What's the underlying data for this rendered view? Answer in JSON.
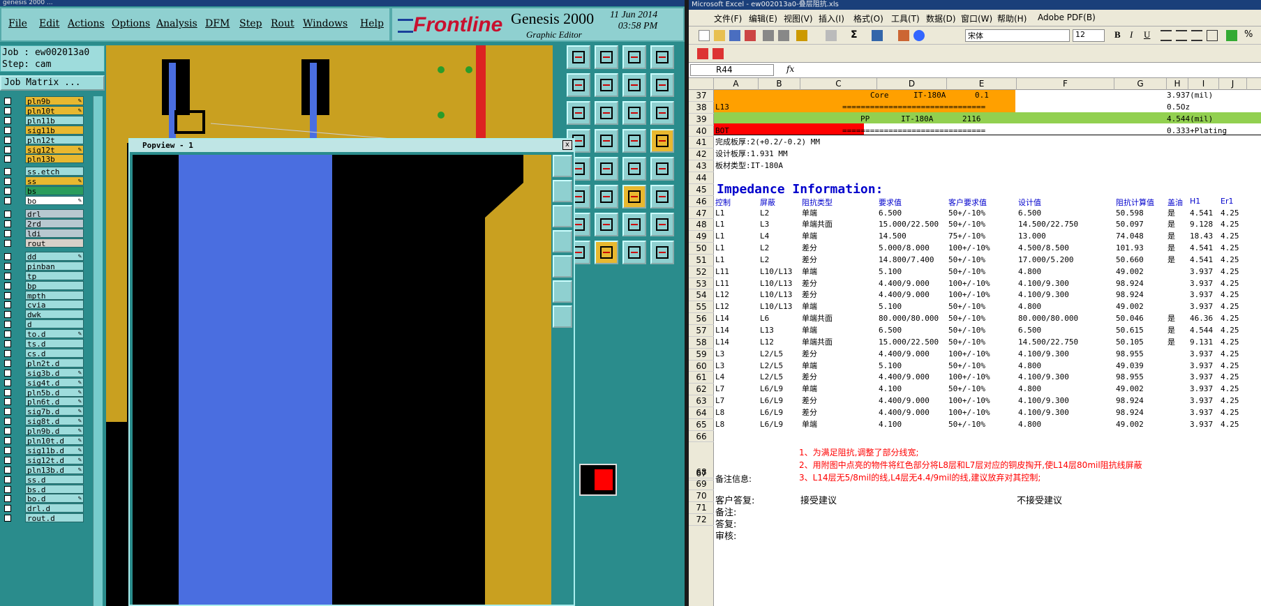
{
  "genesis": {
    "title_bar": "genesis 2000 ...",
    "menu": [
      "File",
      "Edit",
      "Actions",
      "Options",
      "Analysis",
      "DFM",
      "Step",
      "Rout",
      "Windows",
      "Help"
    ],
    "logo": "Frontline",
    "product": "Genesis 2000",
    "subtitle": "Graphic Editor",
    "date": "11 Jun 2014",
    "time": "03:58 PM",
    "job_line": "Job : ew002013a0",
    "step_line": "Step: cam",
    "job_matrix": "Job Matrix ...",
    "layers": [
      {
        "name": "pln9b",
        "color": "#e8b830",
        "edit": true
      },
      {
        "name": "pln10t",
        "color": "#e8b830",
        "edit": true
      },
      {
        "name": "pln11b",
        "color": "#9edcdc",
        "edit": false
      },
      {
        "name": "sig11b",
        "color": "#e8b830",
        "edit": false
      },
      {
        "name": "pln12t",
        "color": "#9edcdc",
        "edit": false
      },
      {
        "name": "sig12t",
        "color": "#e8b830",
        "edit": true
      },
      {
        "name": "pln13b",
        "color": "#e8b830",
        "edit": false
      },
      {
        "name": "ss.etch",
        "color": "#9edcdc",
        "edit": false
      },
      {
        "name": "ss",
        "color": "#e8b830",
        "edit": true
      },
      {
        "name": "bs",
        "color": "#2a9c5c",
        "edit": false
      },
      {
        "name": "bo",
        "color": "#ffffff",
        "edit": true
      },
      {
        "name": "drl",
        "color": "#b8c8d0",
        "edit": false
      },
      {
        "name": "2rd",
        "color": "#b8c8d0",
        "edit": false
      },
      {
        "name": "ldi",
        "color": "#b8c8d0",
        "edit": false
      },
      {
        "name": "rout",
        "color": "#d8d0c8",
        "edit": false
      },
      {
        "name": "dd",
        "color": "#9edcdc",
        "edit": true
      },
      {
        "name": "pinban",
        "color": "#9edcdc",
        "edit": false
      },
      {
        "name": "tp",
        "color": "#9edcdc",
        "edit": false
      },
      {
        "name": "bp",
        "color": "#9edcdc",
        "edit": false
      },
      {
        "name": "mpth",
        "color": "#9edcdc",
        "edit": false
      },
      {
        "name": "cvia",
        "color": "#9edcdc",
        "edit": false
      },
      {
        "name": "dwk",
        "color": "#9edcdc",
        "edit": false
      },
      {
        "name": "d",
        "color": "#9edcdc",
        "edit": false
      },
      {
        "name": "to.d",
        "color": "#9edcdc",
        "edit": true
      },
      {
        "name": "ts.d",
        "color": "#9edcdc",
        "edit": false
      },
      {
        "name": "cs.d",
        "color": "#9edcdc",
        "edit": false
      },
      {
        "name": "pln2t.d",
        "color": "#9edcdc",
        "edit": false
      },
      {
        "name": "sig3b.d",
        "color": "#9edcdc",
        "edit": true
      },
      {
        "name": "sig4t.d",
        "color": "#9edcdc",
        "edit": true
      },
      {
        "name": "pln5b.d",
        "color": "#9edcdc",
        "edit": true
      },
      {
        "name": "pln6t.d",
        "color": "#9edcdc",
        "edit": true
      },
      {
        "name": "sig7b.d",
        "color": "#9edcdc",
        "edit": true
      },
      {
        "name": "sig8t.d",
        "color": "#9edcdc",
        "edit": true
      },
      {
        "name": "pln9b.d",
        "color": "#9edcdc",
        "edit": true
      },
      {
        "name": "pln10t.d",
        "color": "#9edcdc",
        "edit": true
      },
      {
        "name": "sig11b.d",
        "color": "#9edcdc",
        "edit": true
      },
      {
        "name": "sig12t.d",
        "color": "#9edcdc",
        "edit": true
      },
      {
        "name": "pln13b.d",
        "color": "#9edcdc",
        "edit": true
      },
      {
        "name": "ss.d",
        "color": "#9edcdc",
        "edit": false
      },
      {
        "name": "bs.d",
        "color": "#9edcdc",
        "edit": false
      },
      {
        "name": "bo.d",
        "color": "#9edcdc",
        "edit": true
      },
      {
        "name": "drl.d",
        "color": "#9edcdc",
        "edit": false
      },
      {
        "name": "rout.d",
        "color": "#9edcdc",
        "edit": false
      }
    ],
    "popview_title": "Popview - 1",
    "popview_close": "x"
  },
  "excel": {
    "title": "Microsoft Excel - ew002013a0-叠层阻抗.xls",
    "menu": [
      "文件(F)",
      "编辑(E)",
      "视图(V)",
      "插入(I)",
      "格式(O)",
      "工具(T)",
      "数据(D)",
      "窗口(W)",
      "帮助(H)",
      "Adobe PDF(B)"
    ],
    "font_name": "宋体",
    "font_size": "12",
    "name_box": "R44",
    "fx": "fx",
    "columns": [
      "A",
      "B",
      "C",
      "D",
      "E",
      "F",
      "G",
      "H",
      "I",
      "J"
    ],
    "rows": [
      "37",
      "38",
      "39",
      "40",
      "41",
      "42",
      "43",
      "44",
      "45",
      "46",
      "47",
      "48",
      "49",
      "50",
      "51",
      "52",
      "53",
      "54",
      "55",
      "56",
      "57",
      "58",
      "59",
      "60",
      "61",
      "62",
      "63",
      "64",
      "65",
      "66",
      "67",
      "68",
      "69",
      "70",
      "71",
      "72"
    ],
    "stack": {
      "r37": [
        "Core",
        "IT-180A",
        "0.1",
        "3.937(mil)"
      ],
      "r38": [
        "L13",
        "===============================",
        "0.5Oz"
      ],
      "r39": [
        "PP",
        "IT-180A",
        "2116",
        "4.544(mil)"
      ],
      "r40": [
        "BOT",
        "===============================",
        "0.333+Plating"
      ]
    },
    "info": [
      "完成板厚:2(+0.2/-0.2) MM",
      "设计板厚:1.931 MM",
      "板材类型:IT-180A"
    ],
    "imp_title": "Impedance Information:",
    "imp_headers": [
      "控制",
      "屏蔽",
      "阻抗类型",
      "要求值",
      "客户要求值",
      "设计值",
      "阻抗计算值",
      "盖油",
      "H1",
      "Er1"
    ],
    "imp_rows": [
      [
        "L1",
        "L2",
        "单端",
        "6.500",
        "50+/-10%",
        "6.500",
        "50.598",
        "是",
        "4.541",
        "4.25"
      ],
      [
        "L1",
        "L3",
        "单端共面",
        "15.000/22.500",
        "50+/-10%",
        "14.500/22.750",
        "50.097",
        "是",
        "9.128",
        "4.25"
      ],
      [
        "L1",
        "L4",
        "单端",
        "14.500",
        "75+/-10%",
        "13.000",
        "74.048",
        "是",
        "18.43",
        "4.25"
      ],
      [
        "L1",
        "L2",
        "差分",
        "5.000/8.000",
        "100+/-10%",
        "4.500/8.500",
        "101.93",
        "是",
        "4.541",
        "4.25"
      ],
      [
        "L1",
        "L2",
        "差分",
        "14.800/7.400",
        "50+/-10%",
        "17.000/5.200",
        "50.660",
        "是",
        "4.541",
        "4.25"
      ],
      [
        "L11",
        "L10/L13",
        "单端",
        "5.100",
        "50+/-10%",
        "4.800",
        "49.002",
        "",
        "3.937",
        "4.25"
      ],
      [
        "L11",
        "L10/L13",
        "差分",
        "4.400/9.000",
        "100+/-10%",
        "4.100/9.300",
        "98.924",
        "",
        "3.937",
        "4.25"
      ],
      [
        "L12",
        "L10/L13",
        "差分",
        "4.400/9.000",
        "100+/-10%",
        "4.100/9.300",
        "98.924",
        "",
        "3.937",
        "4.25"
      ],
      [
        "L12",
        "L10/L13",
        "单端",
        "5.100",
        "50+/-10%",
        "4.800",
        "49.002",
        "",
        "3.937",
        "4.25"
      ],
      [
        "L14",
        "L6",
        "单端共面",
        "80.000/80.000",
        "50+/-10%",
        "80.000/80.000",
        "50.046",
        "是",
        "46.36",
        "4.25"
      ],
      [
        "L14",
        "L13",
        "单端",
        "6.500",
        "50+/-10%",
        "6.500",
        "50.615",
        "是",
        "4.544",
        "4.25"
      ],
      [
        "L14",
        "L12",
        "单端共面",
        "15.000/22.500",
        "50+/-10%",
        "14.500/22.750",
        "50.105",
        "是",
        "9.131",
        "4.25"
      ],
      [
        "L3",
        "L2/L5",
        "差分",
        "4.400/9.000",
        "100+/-10%",
        "4.100/9.300",
        "98.955",
        "",
        "3.937",
        "4.25"
      ],
      [
        "L3",
        "L2/L5",
        "单端",
        "5.100",
        "50+/-10%",
        "4.800",
        "49.039",
        "",
        "3.937",
        "4.25"
      ],
      [
        "L4",
        "L2/L5",
        "差分",
        "4.400/9.000",
        "100+/-10%",
        "4.100/9.300",
        "98.955",
        "",
        "3.937",
        "4.25"
      ],
      [
        "L7",
        "L6/L9",
        "单端",
        "4.100",
        "50+/-10%",
        "4.800",
        "49.002",
        "",
        "3.937",
        "4.25"
      ],
      [
        "L7",
        "L6/L9",
        "差分",
        "4.400/9.000",
        "100+/-10%",
        "4.100/9.300",
        "98.924",
        "",
        "3.937",
        "4.25"
      ],
      [
        "L8",
        "L6/L9",
        "差分",
        "4.400/9.000",
        "100+/-10%",
        "4.100/9.300",
        "98.924",
        "",
        "3.937",
        "4.25"
      ],
      [
        "L8",
        "L6/L9",
        "单端",
        "4.100",
        "50+/-10%",
        "4.800",
        "49.002",
        "",
        "3.937",
        "4.25"
      ]
    ],
    "notes": [
      "1、为满足阻抗,调整了部分线宽;",
      "2、用附图中点亮的物件将红色部分将L8层和L7层对应的铜皮掏开,使L14层80mil阻抗线屏蔽",
      "3、L14层无5/8mil的线,L4层无4.4/9mil的线,建议放弃对其控制;"
    ],
    "remark_label": "备注信息:",
    "reply_label": "客户答复:",
    "accept": "接受建议",
    "reject": "不接受建议",
    "remark2": "备注:",
    "reply2": "答复:",
    "review": "审核:",
    "colors": {
      "stack_bar": "#ffa000",
      "header_green": "#92d050",
      "header_red": "#ff0000",
      "title_blue": "#0000cc",
      "note_red": "#ff0000"
    }
  }
}
